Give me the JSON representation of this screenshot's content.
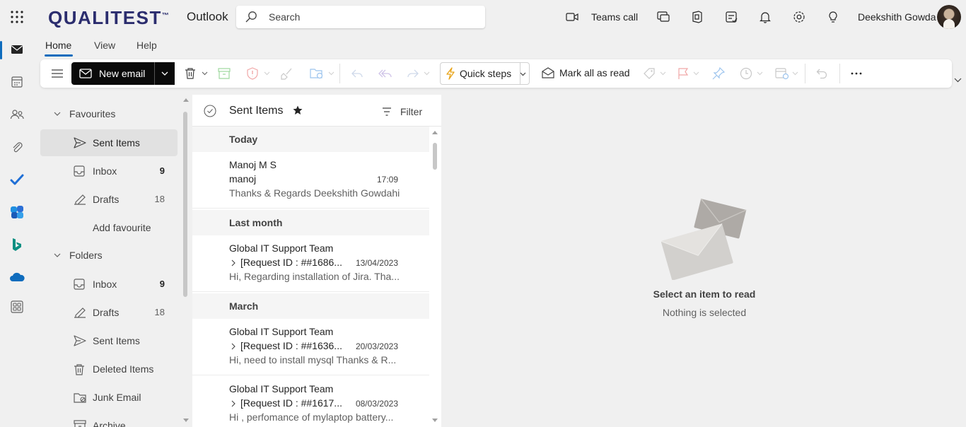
{
  "brand": {
    "logo": "QUALITEST",
    "logo_mark": "™",
    "app_name": "Outlook"
  },
  "search": {
    "placeholder": "Search"
  },
  "header": {
    "teams_call": "Teams call",
    "user_name": "Deekshith Gowda"
  },
  "tabs": [
    {
      "label": "Home",
      "active": true
    },
    {
      "label": "View"
    },
    {
      "label": "Help"
    }
  ],
  "ribbon": {
    "new_email": "New email",
    "quick_steps": "Quick steps",
    "mark_all_read": "Mark all as read"
  },
  "folders": {
    "favourites_label": "Favourites",
    "favourites": [
      {
        "label": "Sent Items",
        "count": "",
        "selected": true,
        "icon": "send-icon"
      },
      {
        "label": "Inbox",
        "count": "9",
        "icon": "inbox-icon"
      },
      {
        "label": "Drafts",
        "count": "18",
        "icon": "drafts-icon"
      }
    ],
    "add_favourite": "Add favourite",
    "folders_label": "Folders",
    "items": [
      {
        "label": "Inbox",
        "count": "9",
        "icon": "inbox-icon"
      },
      {
        "label": "Drafts",
        "count": "18",
        "icon": "drafts-icon"
      },
      {
        "label": "Sent Items",
        "count": "",
        "icon": "send-icon"
      },
      {
        "label": "Deleted Items",
        "count": "",
        "icon": "trash-icon"
      },
      {
        "label": "Junk Email",
        "count": "",
        "icon": "junk-icon"
      },
      {
        "label": "Archive",
        "count": "",
        "icon": "archive-icon"
      }
    ]
  },
  "message_list": {
    "title": "Sent Items",
    "filter": "Filter",
    "groups": [
      {
        "label": "Today",
        "messages": [
          {
            "from": "Manoj M S",
            "subject": "manoj",
            "time": "17:09",
            "preview": "Thanks & Regards Deekshith Gowdahi"
          }
        ]
      },
      {
        "label": "Last month",
        "messages": [
          {
            "from": "Global IT Support Team",
            "subject": "[Request ID : ##1686...",
            "time": "13/04/2023",
            "preview": "Hi, Regarding installation of Jira. Tha..."
          }
        ]
      },
      {
        "label": "March",
        "messages": [
          {
            "from": "Global IT Support Team",
            "subject": "[Request ID : ##1636...",
            "time": "20/03/2023",
            "preview": "Hi, need to install mysql Thanks & R..."
          },
          {
            "from": "Global IT Support Team",
            "subject": "[Request ID : ##1617...",
            "time": "08/03/2023",
            "preview": "Hi , perfomance of mylaptop battery..."
          }
        ]
      }
    ]
  },
  "reading_pane": {
    "title": "Select an item to read",
    "subtitle": "Nothing is selected"
  },
  "colors": {
    "accent": "#0f6cbd",
    "logo": "#2b2d6e",
    "new_email_bg": "#0a0a0a",
    "selected_folder": "#e1e1e1"
  }
}
